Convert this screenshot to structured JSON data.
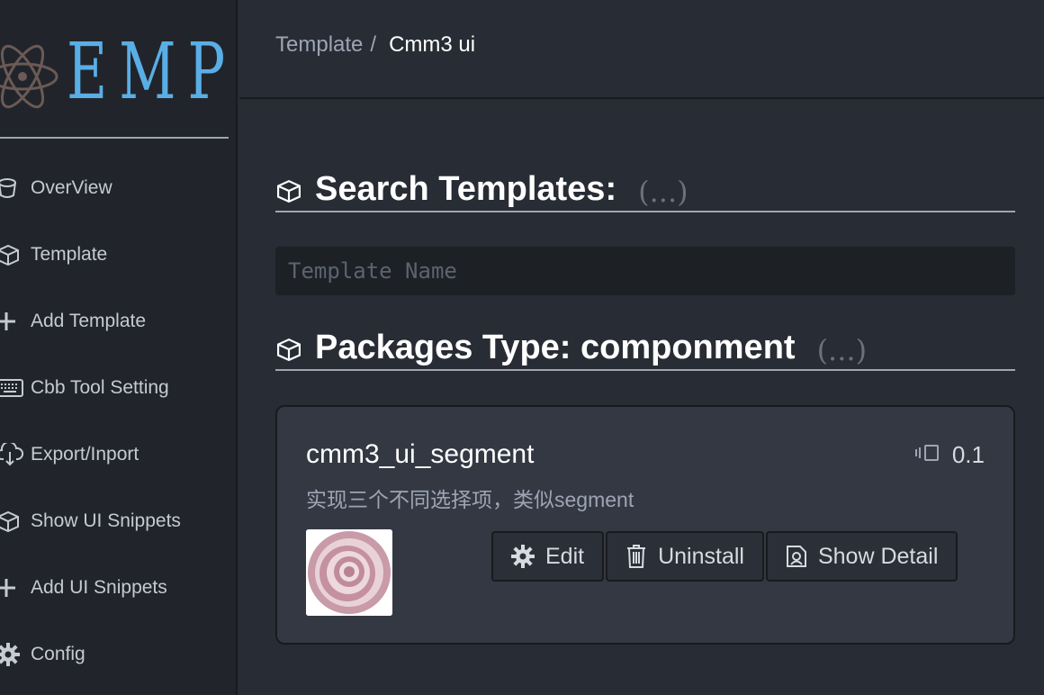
{
  "app": {
    "logo_text": "EMP"
  },
  "sidebar": {
    "items": [
      {
        "label": "OverView",
        "icon": "bucket-icon"
      },
      {
        "label": "Template",
        "icon": "box-icon"
      },
      {
        "label": "Add Template",
        "icon": "plus-icon"
      },
      {
        "label": "Cbb Tool Setting",
        "icon": "keyboard-icon"
      },
      {
        "label": "Export/Inport",
        "icon": "cloud-download-icon"
      },
      {
        "label": "Show UI Snippets",
        "icon": "box-icon"
      },
      {
        "label": "Add UI Snippets",
        "icon": "plus-icon"
      },
      {
        "label": "Config",
        "icon": "gear-icon"
      }
    ]
  },
  "breadcrumb": {
    "parent": "Template",
    "separator": "/",
    "current": "Cmm3 ui"
  },
  "search_section": {
    "title": "Search Templates:",
    "more": "(...)",
    "placeholder": "Template Name",
    "value": ""
  },
  "packages_section": {
    "title": "Packages Type: componment",
    "more": "(...)"
  },
  "package": {
    "name": "cmm3_ui_segment",
    "version": "0.1",
    "description": "实现三个不同选择项，类似segment",
    "buttons": {
      "edit": "Edit",
      "uninstall": "Uninstall",
      "detail": "Show Detail"
    }
  },
  "colors": {
    "accent": "#5aaee6",
    "background": "#282c34",
    "sidebar": "#21252b",
    "card": "#333843"
  }
}
